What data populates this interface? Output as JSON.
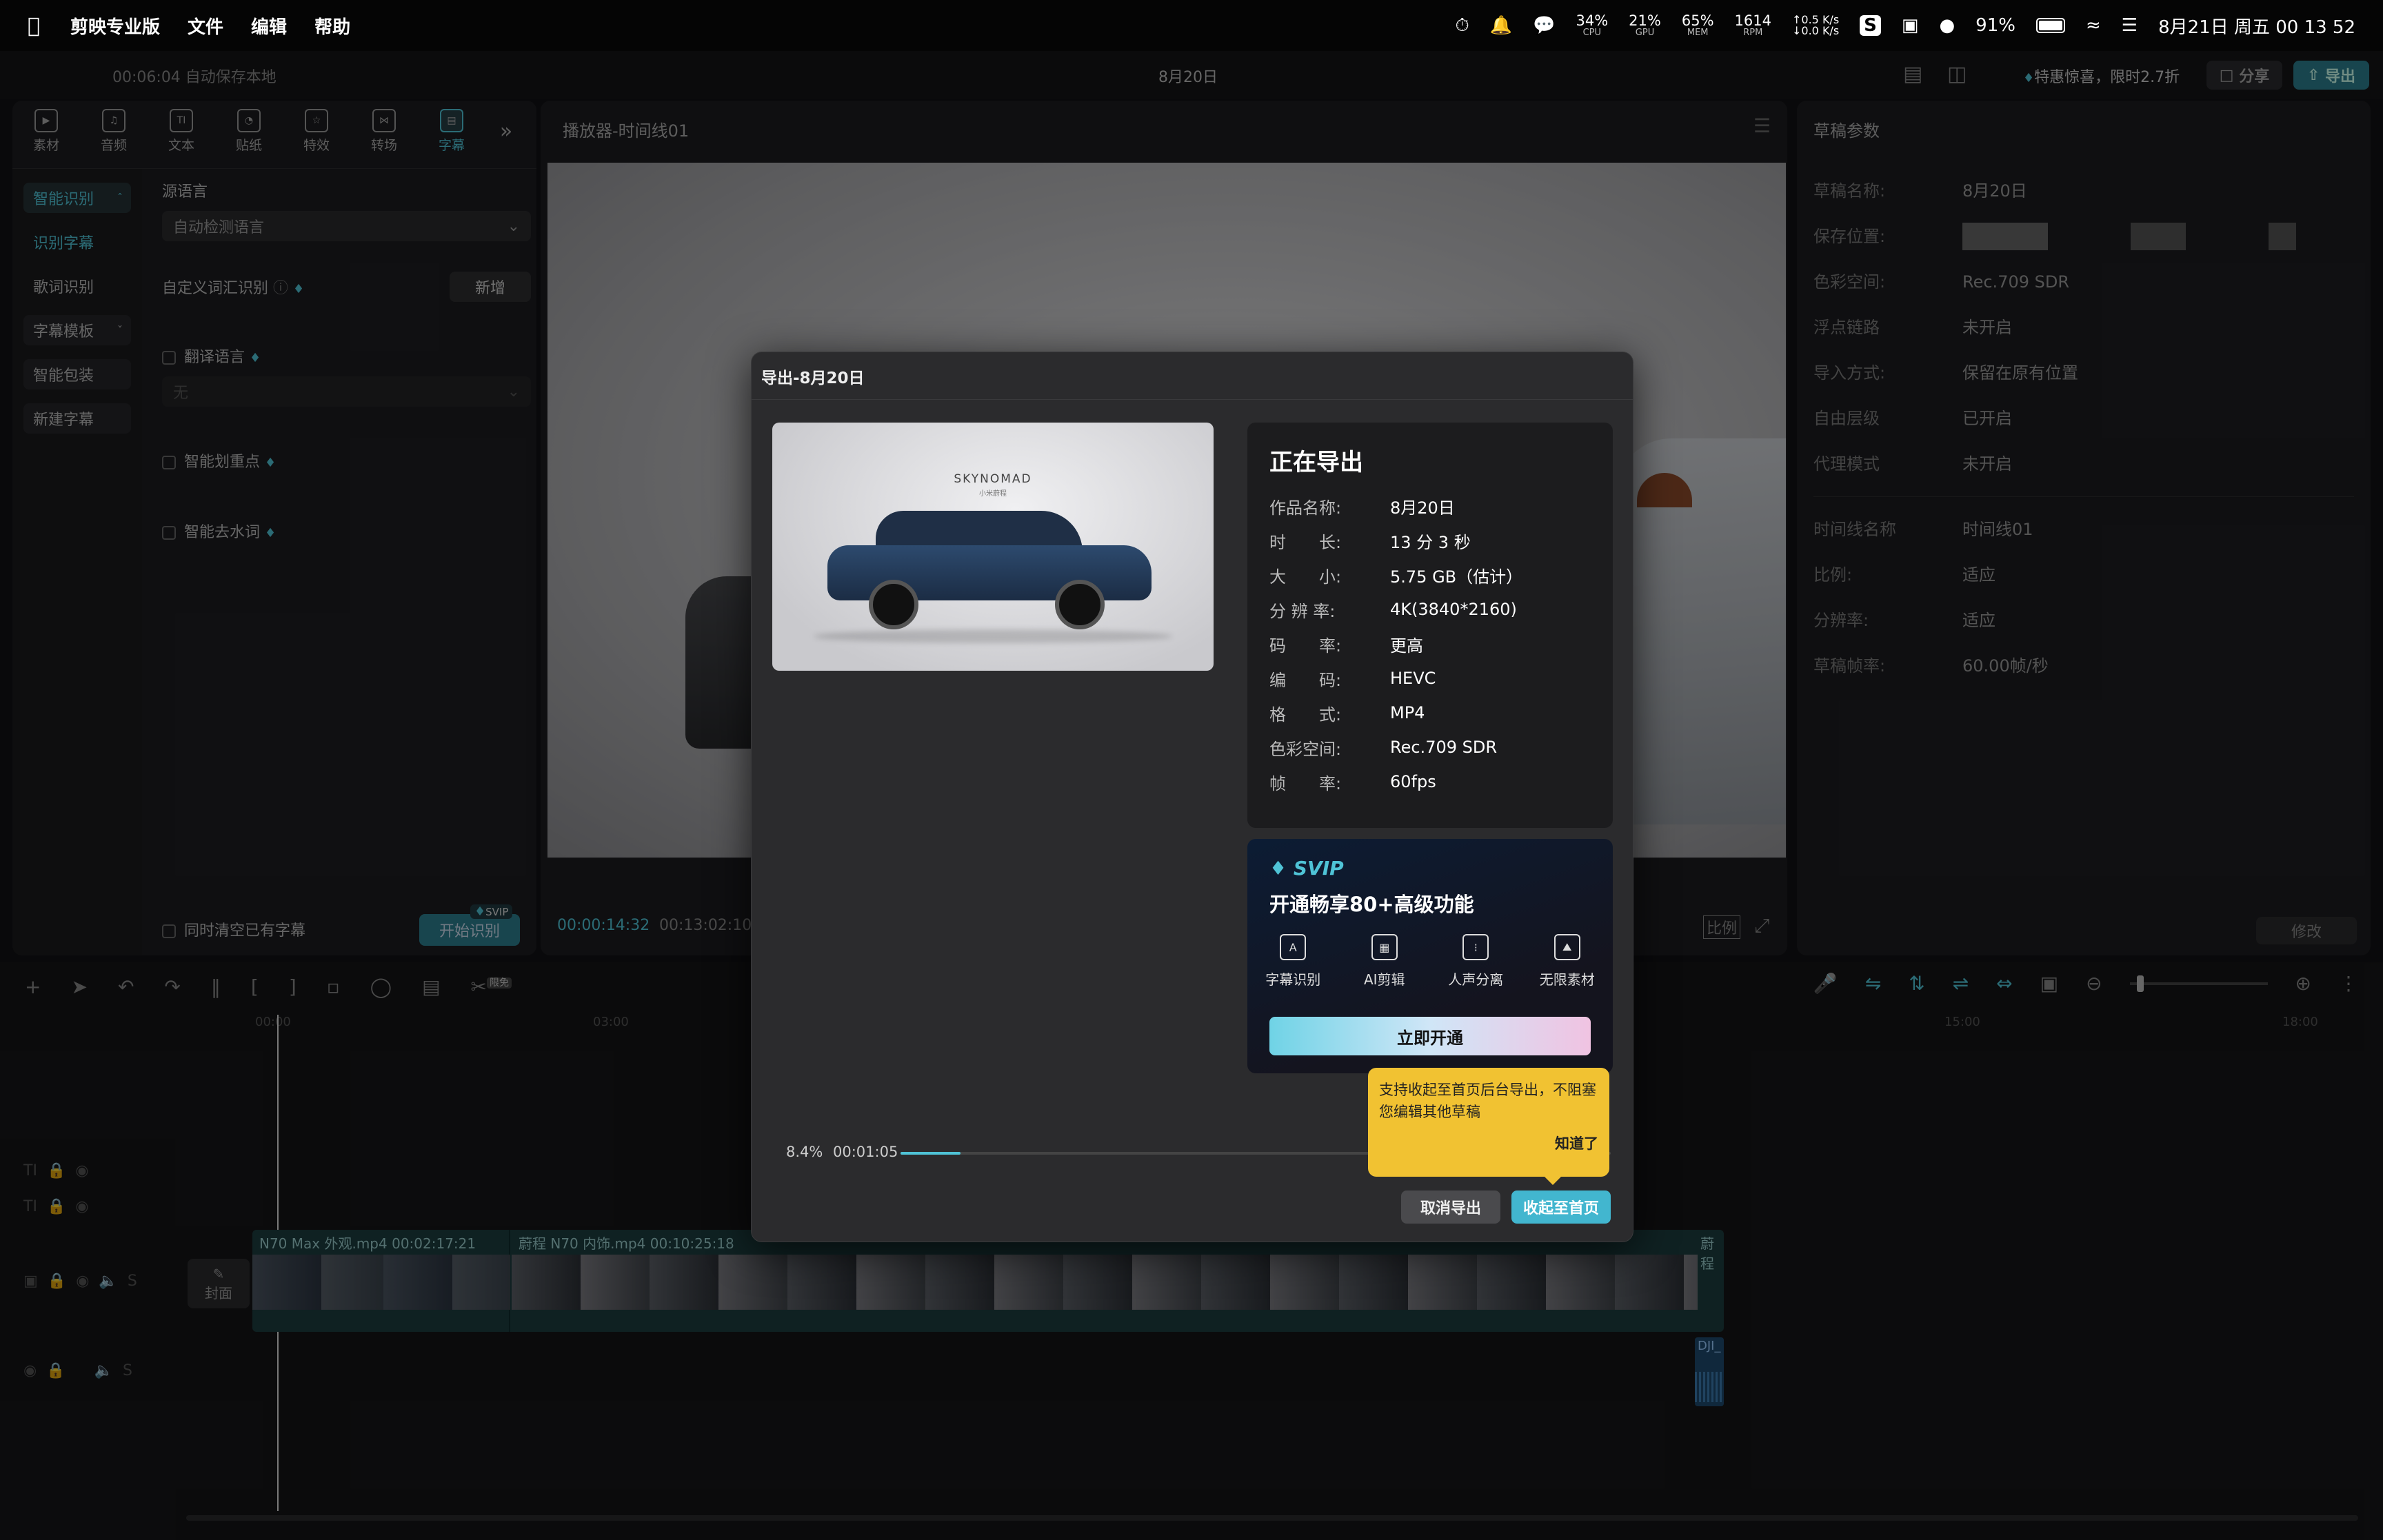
{
  "menubar": {
    "app_name": "剪映专业版",
    "menus": [
      "文件",
      "编辑",
      "帮助"
    ],
    "stats": [
      {
        "value": "34%",
        "label": "CPU"
      },
      {
        "value": "21%",
        "label": "GPU"
      },
      {
        "value": "65%",
        "label": "MEM"
      },
      {
        "value": "1614",
        "label": "RPM"
      }
    ],
    "net_up": "↑0.5 K/s",
    "net_down": "↓0.0 K/s",
    "battery": "91%",
    "datetime": "8月21日 周五  00 13 52"
  },
  "appbar": {
    "autosave": "00:06:04 自动保存本地",
    "project_title": "8月20日",
    "promo": "特惠惊喜，限时2.7折",
    "share": "分享",
    "export": "导出"
  },
  "toolbar": {
    "tabs": [
      {
        "label": "素材",
        "icon": "media-icon"
      },
      {
        "label": "音频",
        "icon": "audio-icon"
      },
      {
        "label": "文本",
        "icon": "text-icon"
      },
      {
        "label": "贴纸",
        "icon": "sticker-icon"
      },
      {
        "label": "特效",
        "icon": "effects-icon"
      },
      {
        "label": "转场",
        "icon": "transition-icon"
      },
      {
        "label": "字幕",
        "icon": "caption-icon"
      }
    ],
    "more": "»"
  },
  "left_sidebar": {
    "items": [
      "智能识别",
      "识别字幕",
      "歌词识别",
      "字幕模板",
      "智能包装",
      "新建字幕"
    ]
  },
  "caption_panel": {
    "source_lang_label": "源语言",
    "source_lang_value": "自动检测语言",
    "custom_vocab_label": "自定义词汇识别",
    "add_button": "新增",
    "translate_label": "翻译语言",
    "translate_value": "无",
    "highlight_label": "智能划重点",
    "filler_label": "智能去水词",
    "clear_label": "同时清空已有字幕",
    "start_button": "开始识别",
    "svip_badge": "SVIP"
  },
  "player": {
    "title": "播放器-时间线01",
    "current_time": "00:00:14:32",
    "total_time": "00:13:02:10",
    "ratio_label": "比例"
  },
  "draft_params": {
    "title": "草稿参数",
    "rows": [
      {
        "k": "草稿名称:",
        "v": "8月20日"
      },
      {
        "k": "保存位置:",
        "v": ""
      },
      {
        "k": "色彩空间:",
        "v": "Rec.709 SDR"
      },
      {
        "k": "浮点链路",
        "v": "未开启"
      },
      {
        "k": "导入方式:",
        "v": "保留在原有位置"
      },
      {
        "k": "自由层级",
        "v": "已开启"
      },
      {
        "k": "代理模式",
        "v": "未开启"
      }
    ],
    "rows2": [
      {
        "k": "时间线名称",
        "v": "时间线01"
      },
      {
        "k": "比例:",
        "v": "适应"
      },
      {
        "k": "分辨率:",
        "v": "适应"
      },
      {
        "k": "草稿帧率:",
        "v": "60.00帧/秒"
      }
    ],
    "edit_button": "修改"
  },
  "timeline": {
    "ruler": [
      "00:00",
      "03:00",
      "15:00",
      "18:00"
    ],
    "clip1_label": "N70 Max 外观.mp4  00:02:17:21",
    "clip2_label": "蔚程 N70 内饰.mp4  00:10:25:18",
    "clip3_label": "蔚程",
    "audio_label": "DJI_",
    "cover_label": "封面",
    "limited_free": "限免"
  },
  "export_dialog": {
    "title": "导出-8月20日",
    "status_title": "正在导出",
    "thumbnail_brand": "SKYNOMAD",
    "thumbnail_brand_sub": "小米蔚程",
    "info": [
      {
        "k": "作品名称:",
        "v": "8月20日"
      },
      {
        "k": "时　　长:",
        "v": "13 分 3 秒"
      },
      {
        "k": "大　　小:",
        "v": "5.75 GB（估计）"
      },
      {
        "k": "分 辨 率:",
        "v": "4K(3840*2160)"
      },
      {
        "k": "码　　率:",
        "v": "更高"
      },
      {
        "k": "编　　码:",
        "v": "HEVC"
      },
      {
        "k": "格　　式:",
        "v": "MP4"
      },
      {
        "k": "色彩空间:",
        "v": "Rec.709 SDR"
      },
      {
        "k": "帧　　率:",
        "v": "60fps"
      }
    ],
    "svip": {
      "badge": "SVIP",
      "headline": "开通畅享80+高级功能",
      "features": [
        {
          "label": "字幕识别",
          "icon": "caption-recognition-icon"
        },
        {
          "label": "AI剪辑",
          "icon": "ai-edit-icon"
        },
        {
          "label": "人声分离",
          "icon": "vocal-separation-icon"
        },
        {
          "label": "无限素材",
          "icon": "unlimited-media-icon"
        }
      ],
      "cta": "立即开通"
    },
    "progress": {
      "percent_text": "8.4%",
      "elapsed": "00:01:05",
      "fraction": 0.084
    },
    "tooltip": {
      "text": "支持收起至首页后台导出，不阻塞您编辑其他草稿",
      "ack": "知道了"
    },
    "cancel_button": "取消导出",
    "minimize_button": "收起至首页"
  },
  "colors": {
    "accent": "#4fc3d6",
    "tooltip": "#f1c232",
    "bg": "#121214"
  }
}
